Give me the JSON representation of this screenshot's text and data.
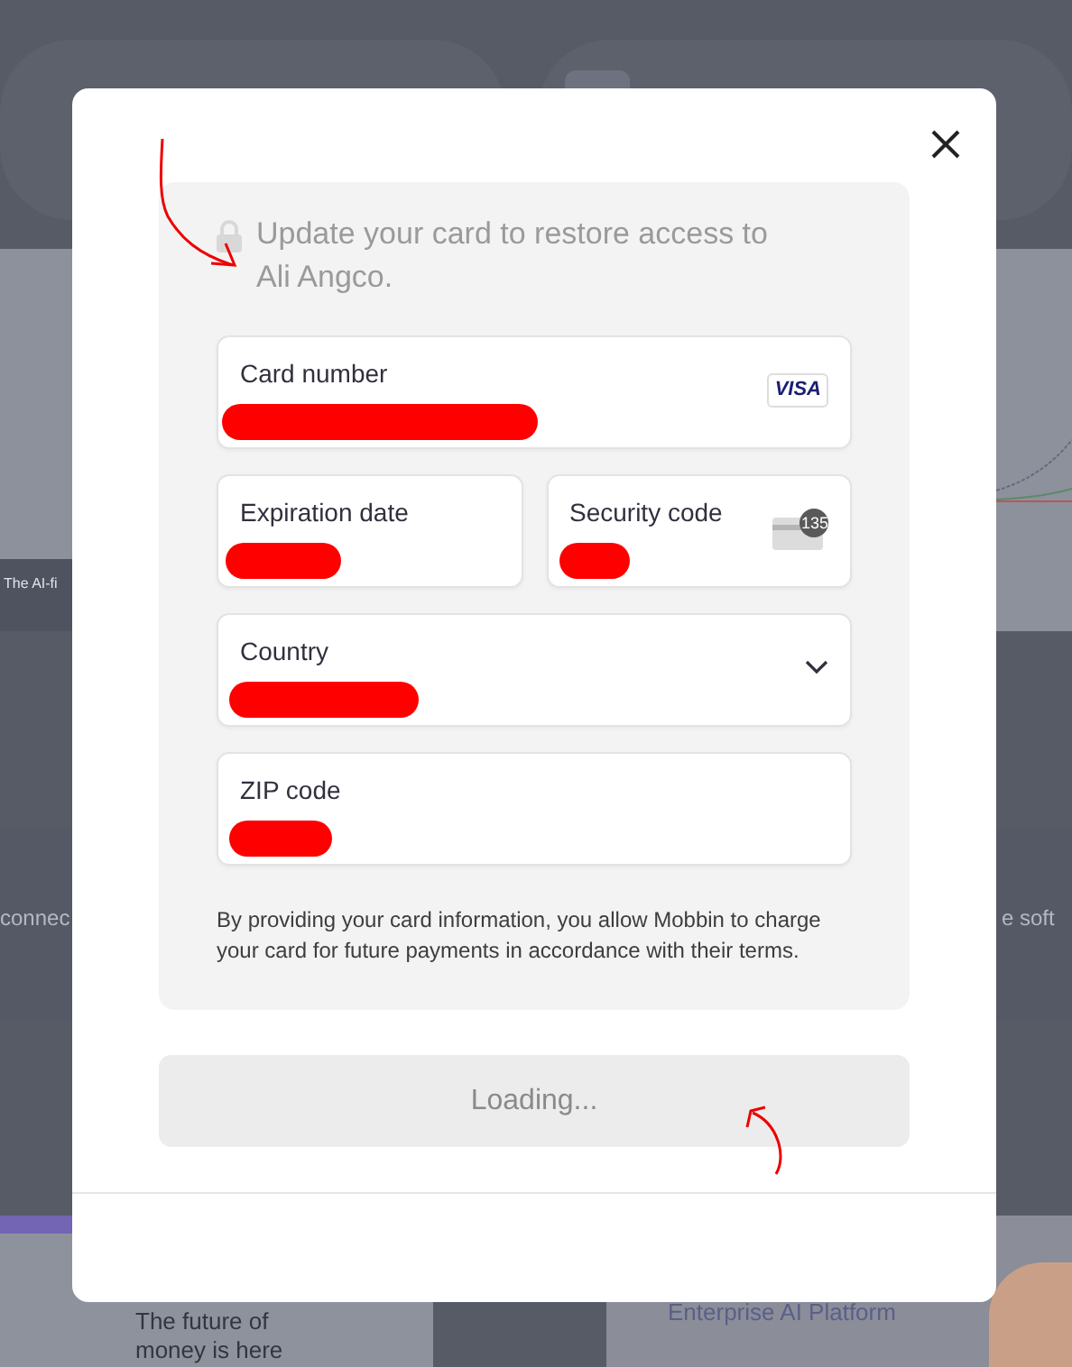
{
  "background": {
    "caption": "The AI-fi",
    "row_left": "connec",
    "row_right": "e soft",
    "headline": [
      "The future of",
      "money is here"
    ],
    "title": "Enterprise AI Platform"
  },
  "notice": {
    "text": "Update your card to restore access to Ali Angco."
  },
  "fields": [
    {
      "kind": "card",
      "label": "Card number",
      "brand": "VISA"
    },
    {
      "kind": "half",
      "label": "Expiration date"
    },
    {
      "kind": "cvc",
      "label": "Security code",
      "cvc": "135"
    },
    {
      "kind": "select",
      "label": "Country"
    },
    {
      "kind": "text",
      "label": "ZIP code"
    }
  ],
  "disclaimer": "By providing your card information, you allow Mobbin to charge your card for future payments in accordance with their terms.",
  "submit": {
    "label": "Loading...",
    "disabled": true
  }
}
